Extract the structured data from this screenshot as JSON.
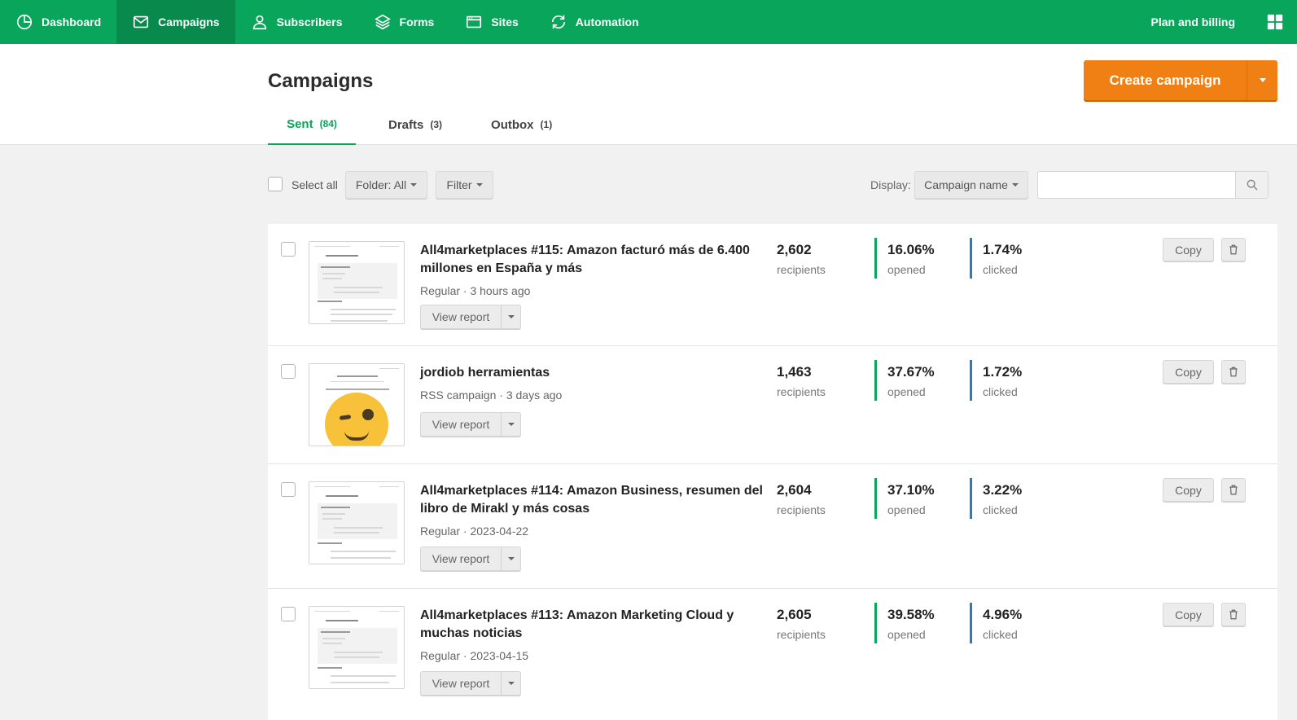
{
  "nav": {
    "items": [
      {
        "label": "Dashboard",
        "icon": "pie-chart-icon"
      },
      {
        "label": "Campaigns",
        "icon": "envelope-icon"
      },
      {
        "label": "Subscribers",
        "icon": "user-icon"
      },
      {
        "label": "Forms",
        "icon": "layers-icon"
      },
      {
        "label": "Sites",
        "icon": "browser-window-icon"
      },
      {
        "label": "Automation",
        "icon": "refresh-icon"
      }
    ],
    "active": "Campaigns",
    "plan_label": "Plan and billing",
    "apps_icon": "grid-icon",
    "bar_color": "#09a55a"
  },
  "header": {
    "title": "Campaigns",
    "create_label": "Create campaign",
    "create_color": "#f08014",
    "tabs": [
      {
        "label": "Sent",
        "count": "(84)"
      },
      {
        "label": "Drafts",
        "count": "(3)"
      },
      {
        "label": "Outbox",
        "count": "(1)"
      }
    ]
  },
  "toolbar": {
    "select_all": "Select all",
    "folder": "Folder: All",
    "filter": "Filter",
    "display_label": "Display:",
    "display_value": "Campaign name",
    "search_value": "",
    "search_placeholder": ""
  },
  "campaigns": [
    {
      "title": "All4marketplaces #115: Amazon facturó más de 6.400 millones en España y más",
      "meta": "Regular · 3 hours ago",
      "recipients": "2,602",
      "recipients_label": "recipients",
      "opened": "16.06%",
      "opened_label": "opened",
      "clicked": "1.74%",
      "clicked_label": "clicked",
      "view_report": "View report",
      "copy": "Copy"
    },
    {
      "title": "jordiob herramientas",
      "meta": "RSS campaign · 3 days ago",
      "recipients": "1,463",
      "recipients_label": "recipients",
      "opened": "37.67%",
      "opened_label": "opened",
      "clicked": "1.72%",
      "clicked_label": "clicked",
      "view_report": "View report",
      "copy": "Copy"
    },
    {
      "title": "All4marketplaces #114: Amazon Business, resumen del libro de Mirakl y más cosas",
      "meta": "Regular · 2023-04-22",
      "recipients": "2,604",
      "recipients_label": "recipients",
      "opened": "37.10%",
      "opened_label": "opened",
      "clicked": "3.22%",
      "clicked_label": "clicked",
      "view_report": "View report",
      "copy": "Copy"
    },
    {
      "title": "All4marketplaces #113: Amazon Marketing Cloud y muchas noticias",
      "meta": "Regular · 2023-04-15",
      "recipients": "2,605",
      "recipients_label": "recipients",
      "opened": "39.58%",
      "opened_label": "opened",
      "clicked": "4.96%",
      "clicked_label": "clicked",
      "view_report": "View report",
      "copy": "Copy"
    }
  ]
}
